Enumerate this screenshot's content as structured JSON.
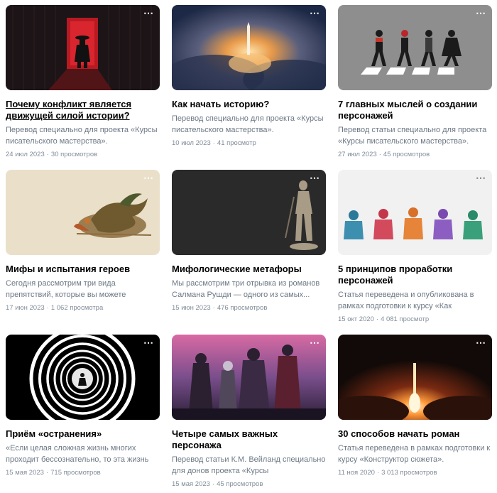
{
  "more_icon": "⋯",
  "articles": [
    {
      "title": "Почему конфликт является движущей силой истории?",
      "desc": "Перевод специально для проекта «Курсы писательского мастерства».",
      "date": "24 июл 2023",
      "views": "30 просмотров",
      "image": "red-door-samurai-illustration"
    },
    {
      "title": "Как начать историю?",
      "desc": "Перевод специально для проекта «Курсы писательского мастерства».",
      "date": "10 июл 2023",
      "views": "41 просмотр",
      "image": "rocket-launch-clouds"
    },
    {
      "title": "7 главных мыслей о создании персонажей",
      "desc": "Перевод статьи специально для проекта «Курсы писательского мастерства».",
      "date": "27 июл 2023",
      "views": "45 просмотров",
      "image": "superheroes-crosswalk"
    },
    {
      "title": "Мифы и испытания героев",
      "desc": "Сегодня рассмотрим три вида препятствий, которые вы можете подготовить для любого...",
      "date": "17 июн 2023",
      "views": "1 062 просмотра",
      "image": "dragon-illustration"
    },
    {
      "title": "Мифологические метафоры",
      "desc": "Мы рассмотрим три отрывка из романов Салмана Рушди — одного из самых...",
      "date": "15 июн 2023",
      "views": "476 просмотров",
      "image": "warrior-statue-dark"
    },
    {
      "title": "5 принципов проработки персонажей",
      "desc": "Статья переведена и опубликована в рамках подготовки к курсу «Как описывать эмоции...",
      "date": "15 окт 2020",
      "views": "4 081 просмотр",
      "image": "character-silhouettes"
    },
    {
      "title": "Приём «остранения»",
      "desc": "«Если целая сложная жизнь многих проходит бессознательно, то эта жизнь как бы не...",
      "date": "15 мая 2023",
      "views": "715 просмотров",
      "image": "spiral-tunnel"
    },
    {
      "title": "Четыре самых важных персонажа",
      "desc": "Перевод статьи К.М. Вейланд специально для донов проекта «Курсы писательского...",
      "date": "15 мая 2023",
      "views": "45 просмотров",
      "image": "fantasy-heroes-group"
    },
    {
      "title": "30 способов начать роман",
      "desc": "Статья переведена в рамках подготовки к курсу «Конструктор сюжета».",
      "date": "11 ноя 2020",
      "views": "3 013 просмотров",
      "image": "rocket-launch-smoke"
    }
  ]
}
